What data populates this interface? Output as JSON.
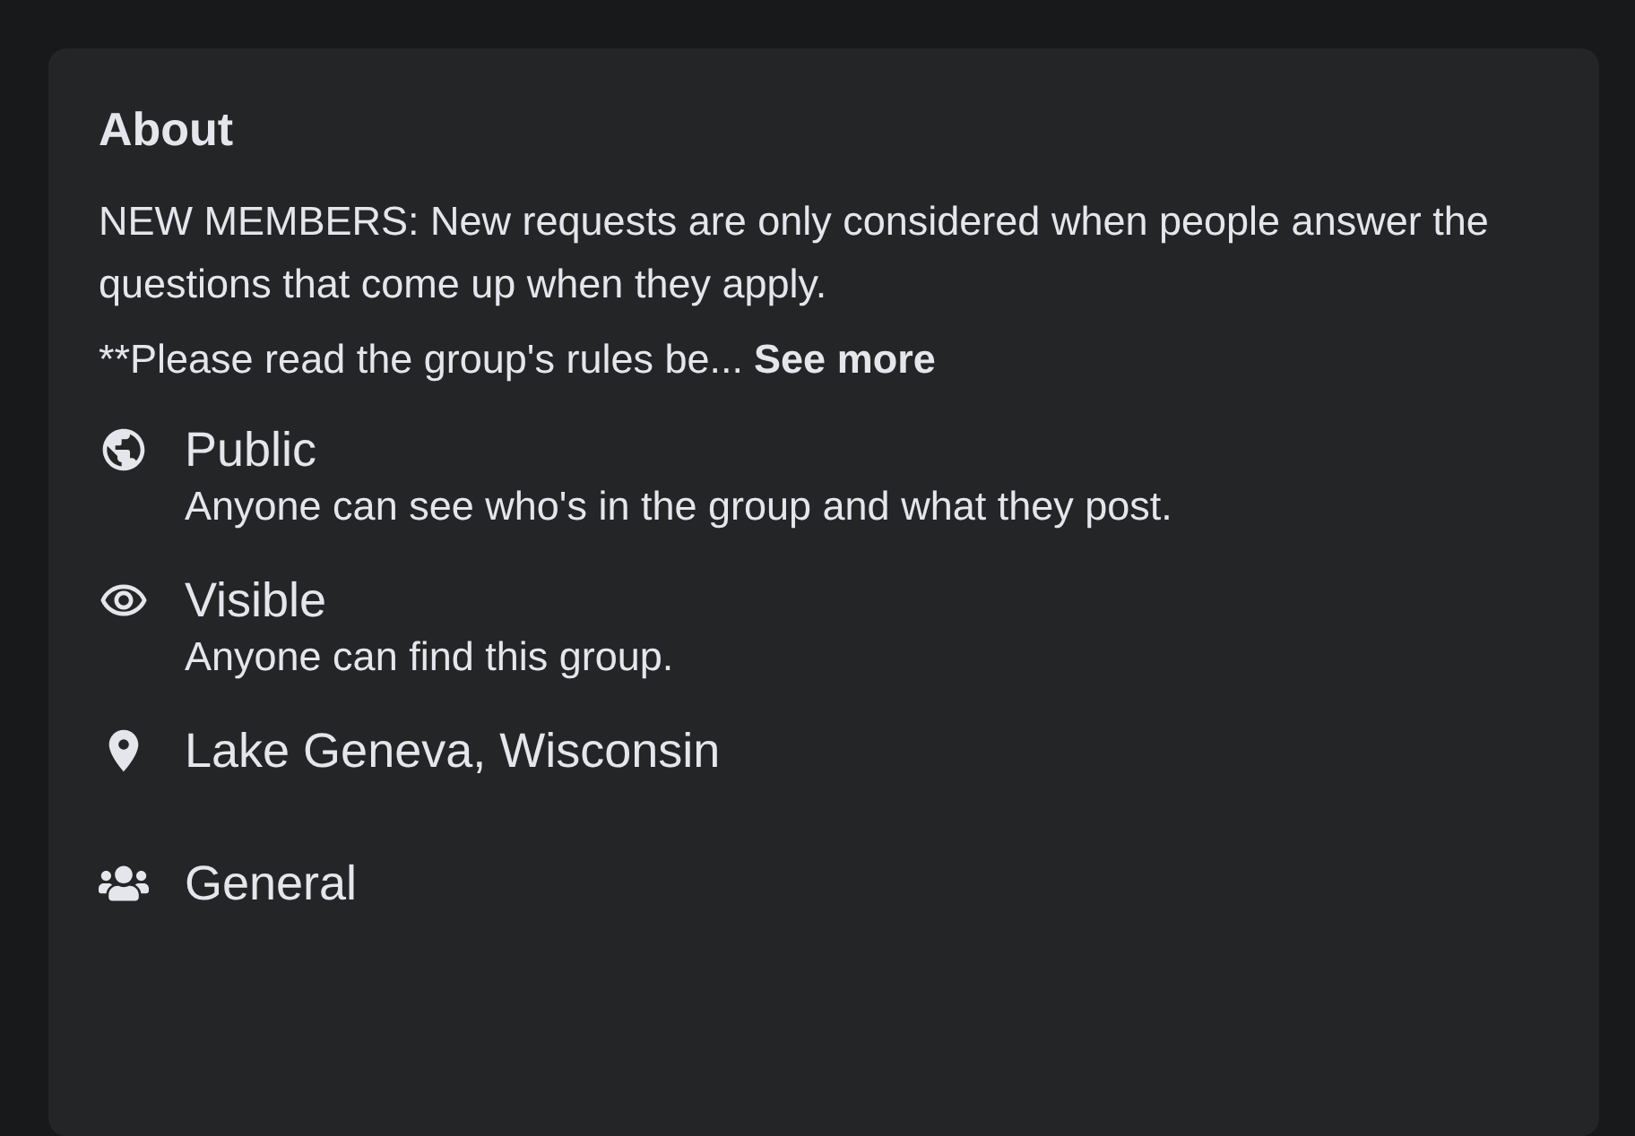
{
  "about": {
    "title": "About",
    "description": "NEW MEMBERS: New requests are only considered when people answer the questions that come up when they apply.",
    "rules_preview": "**Please read the group's rules be...",
    "see_more": "See more",
    "items": [
      {
        "kind": "globe",
        "title": "Public",
        "subtitle": "Anyone can see who's in the group and what they post."
      },
      {
        "kind": "eye",
        "title": "Visible",
        "subtitle": "Anyone can find this group."
      },
      {
        "kind": "pin",
        "title": "Lake Geneva, Wisconsin"
      },
      {
        "kind": "people",
        "title": "General"
      }
    ]
  }
}
